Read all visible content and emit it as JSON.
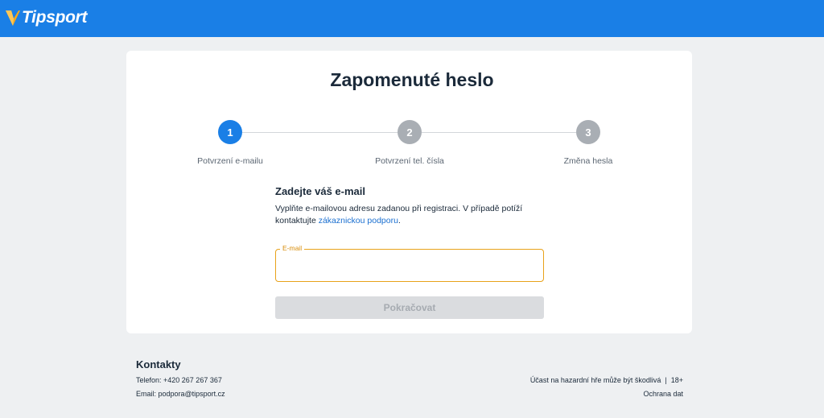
{
  "header": {
    "brand": "Tipsport",
    "bar_color": "#1a7fe6",
    "logo_accent_color": "#f4a81d"
  },
  "page": {
    "title": "Zapomenuté heslo"
  },
  "steps": [
    {
      "number": "1",
      "label": "Potvrzení e-mailu",
      "state": "active"
    },
    {
      "number": "2",
      "label": "Potvrzení tel. čísla",
      "state": "inactive"
    },
    {
      "number": "3",
      "label": "Změna hesla",
      "state": "inactive"
    }
  ],
  "form": {
    "title": "Zadejte váš e-mail",
    "description_before_link": "Vyplňte e-mailovou adresu zadanou při registraci. V případě potíží kontaktujte ",
    "support_link": "zákaznickou podporu",
    "description_after_link": ".",
    "email_label": "E-mail",
    "email_value": "",
    "submit_label": "Pokračovat",
    "focus_color": "#e8a21a"
  },
  "footer": {
    "title": "Kontakty",
    "phone": "Telefon: +420 267 267 367",
    "email": "Email: podpora@tipsport.cz",
    "warning": "Účast na hazardní hře může být škodlivá  |  18+",
    "privacy_link": "Ochrana dat"
  }
}
